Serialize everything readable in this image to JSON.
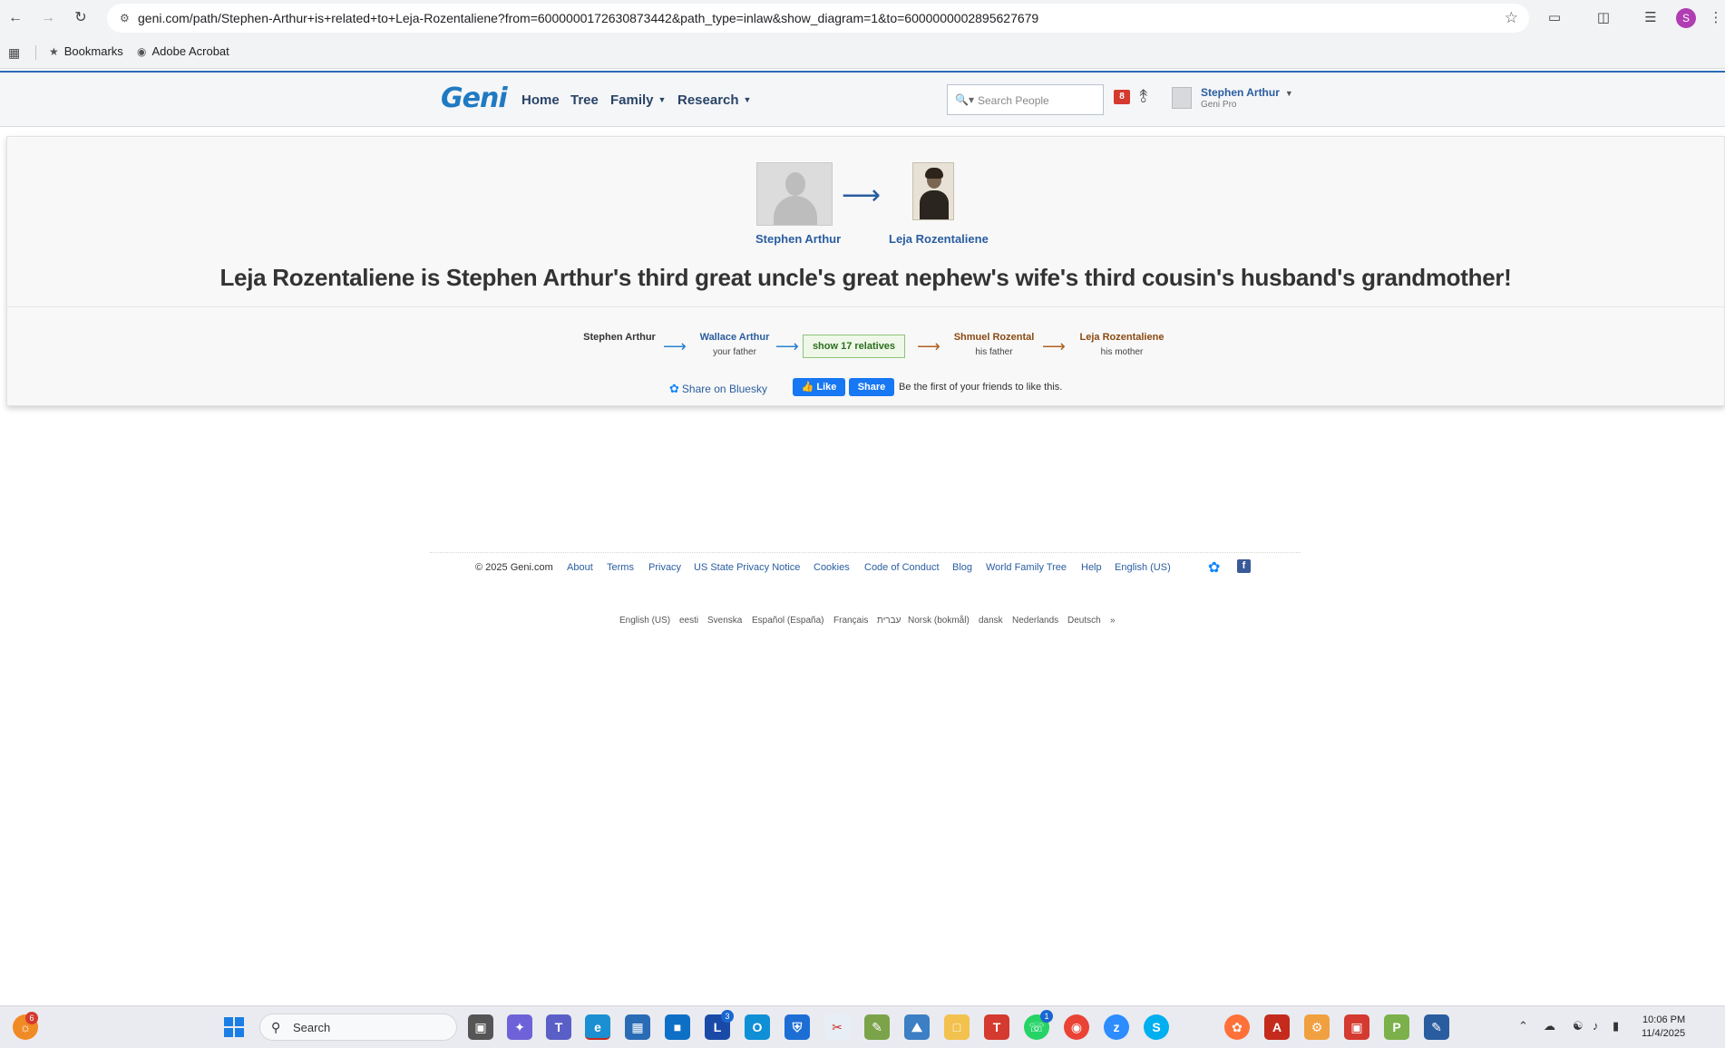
{
  "browser": {
    "url": "geni.com/path/Stephen-Arthur+is+related+to+Leja-Rozentaliene?from=6000000172630873442&path_type=inlaw&show_diagram=1&to=6000000002895627679",
    "profile_initial": "S",
    "bookmarks": [
      {
        "label": "Bookmarks",
        "icon": "star-icon"
      },
      {
        "label": "Adobe Acrobat",
        "icon": "acrobat-icon"
      }
    ]
  },
  "geni_header": {
    "logo": "Geni",
    "nav": [
      {
        "label": "Home",
        "dropdown": false
      },
      {
        "label": "Tree",
        "dropdown": false
      },
      {
        "label": "Family",
        "dropdown": true
      },
      {
        "label": "Research",
        "dropdown": true
      }
    ],
    "search_placeholder": "Search People",
    "notification_count": "8",
    "user_name": "Stephen Arthur",
    "user_subtitle": "Geni Pro"
  },
  "relationship": {
    "from_name": "Stephen Arthur",
    "to_name": "Leja Rozentaliene",
    "headline": "Leja Rozentaliene is Stephen Arthur's third great uncle's great nephew's wife's third cousin's husband's grandmother!",
    "path": [
      {
        "name": "Stephen Arthur",
        "relation": "",
        "color": "#333333"
      },
      {
        "name": "Wallace Arthur",
        "relation": "your father",
        "color": "#2a5d9f"
      },
      {
        "name": "Shmuel Rozental",
        "relation": "his father",
        "color": "#8b4a12"
      },
      {
        "name": "Leja Rozentaliene",
        "relation": "his mother",
        "color": "#8b4a12"
      }
    ],
    "show_relatives_label": "show 17 relatives",
    "share_bluesky_label": "Share on Bluesky",
    "fb_like_label": "Like",
    "fb_share_label": "Share",
    "fb_text": "Be the first of your friends to like this."
  },
  "footer": {
    "copyright": "© 2025 Geni.com",
    "links": [
      "About",
      "Terms",
      "Privacy",
      "US State Privacy Notice",
      "Cookies",
      "Code of Conduct",
      "Blog",
      "World Family Tree",
      "Help",
      "English (US)"
    ],
    "languages": [
      "English (US)",
      "eesti",
      "Svenska",
      "Español (España)",
      "Français",
      "עברית",
      "Norsk (bokmål)",
      "dansk",
      "Nederlands",
      "Deutsch",
      "»"
    ]
  },
  "taskbar": {
    "search_label": "Search",
    "time": "10:06 PM",
    "date": "11/4/2025",
    "badges": {
      "left": "6",
      "app_l": "3",
      "whatsapp": "1"
    }
  }
}
